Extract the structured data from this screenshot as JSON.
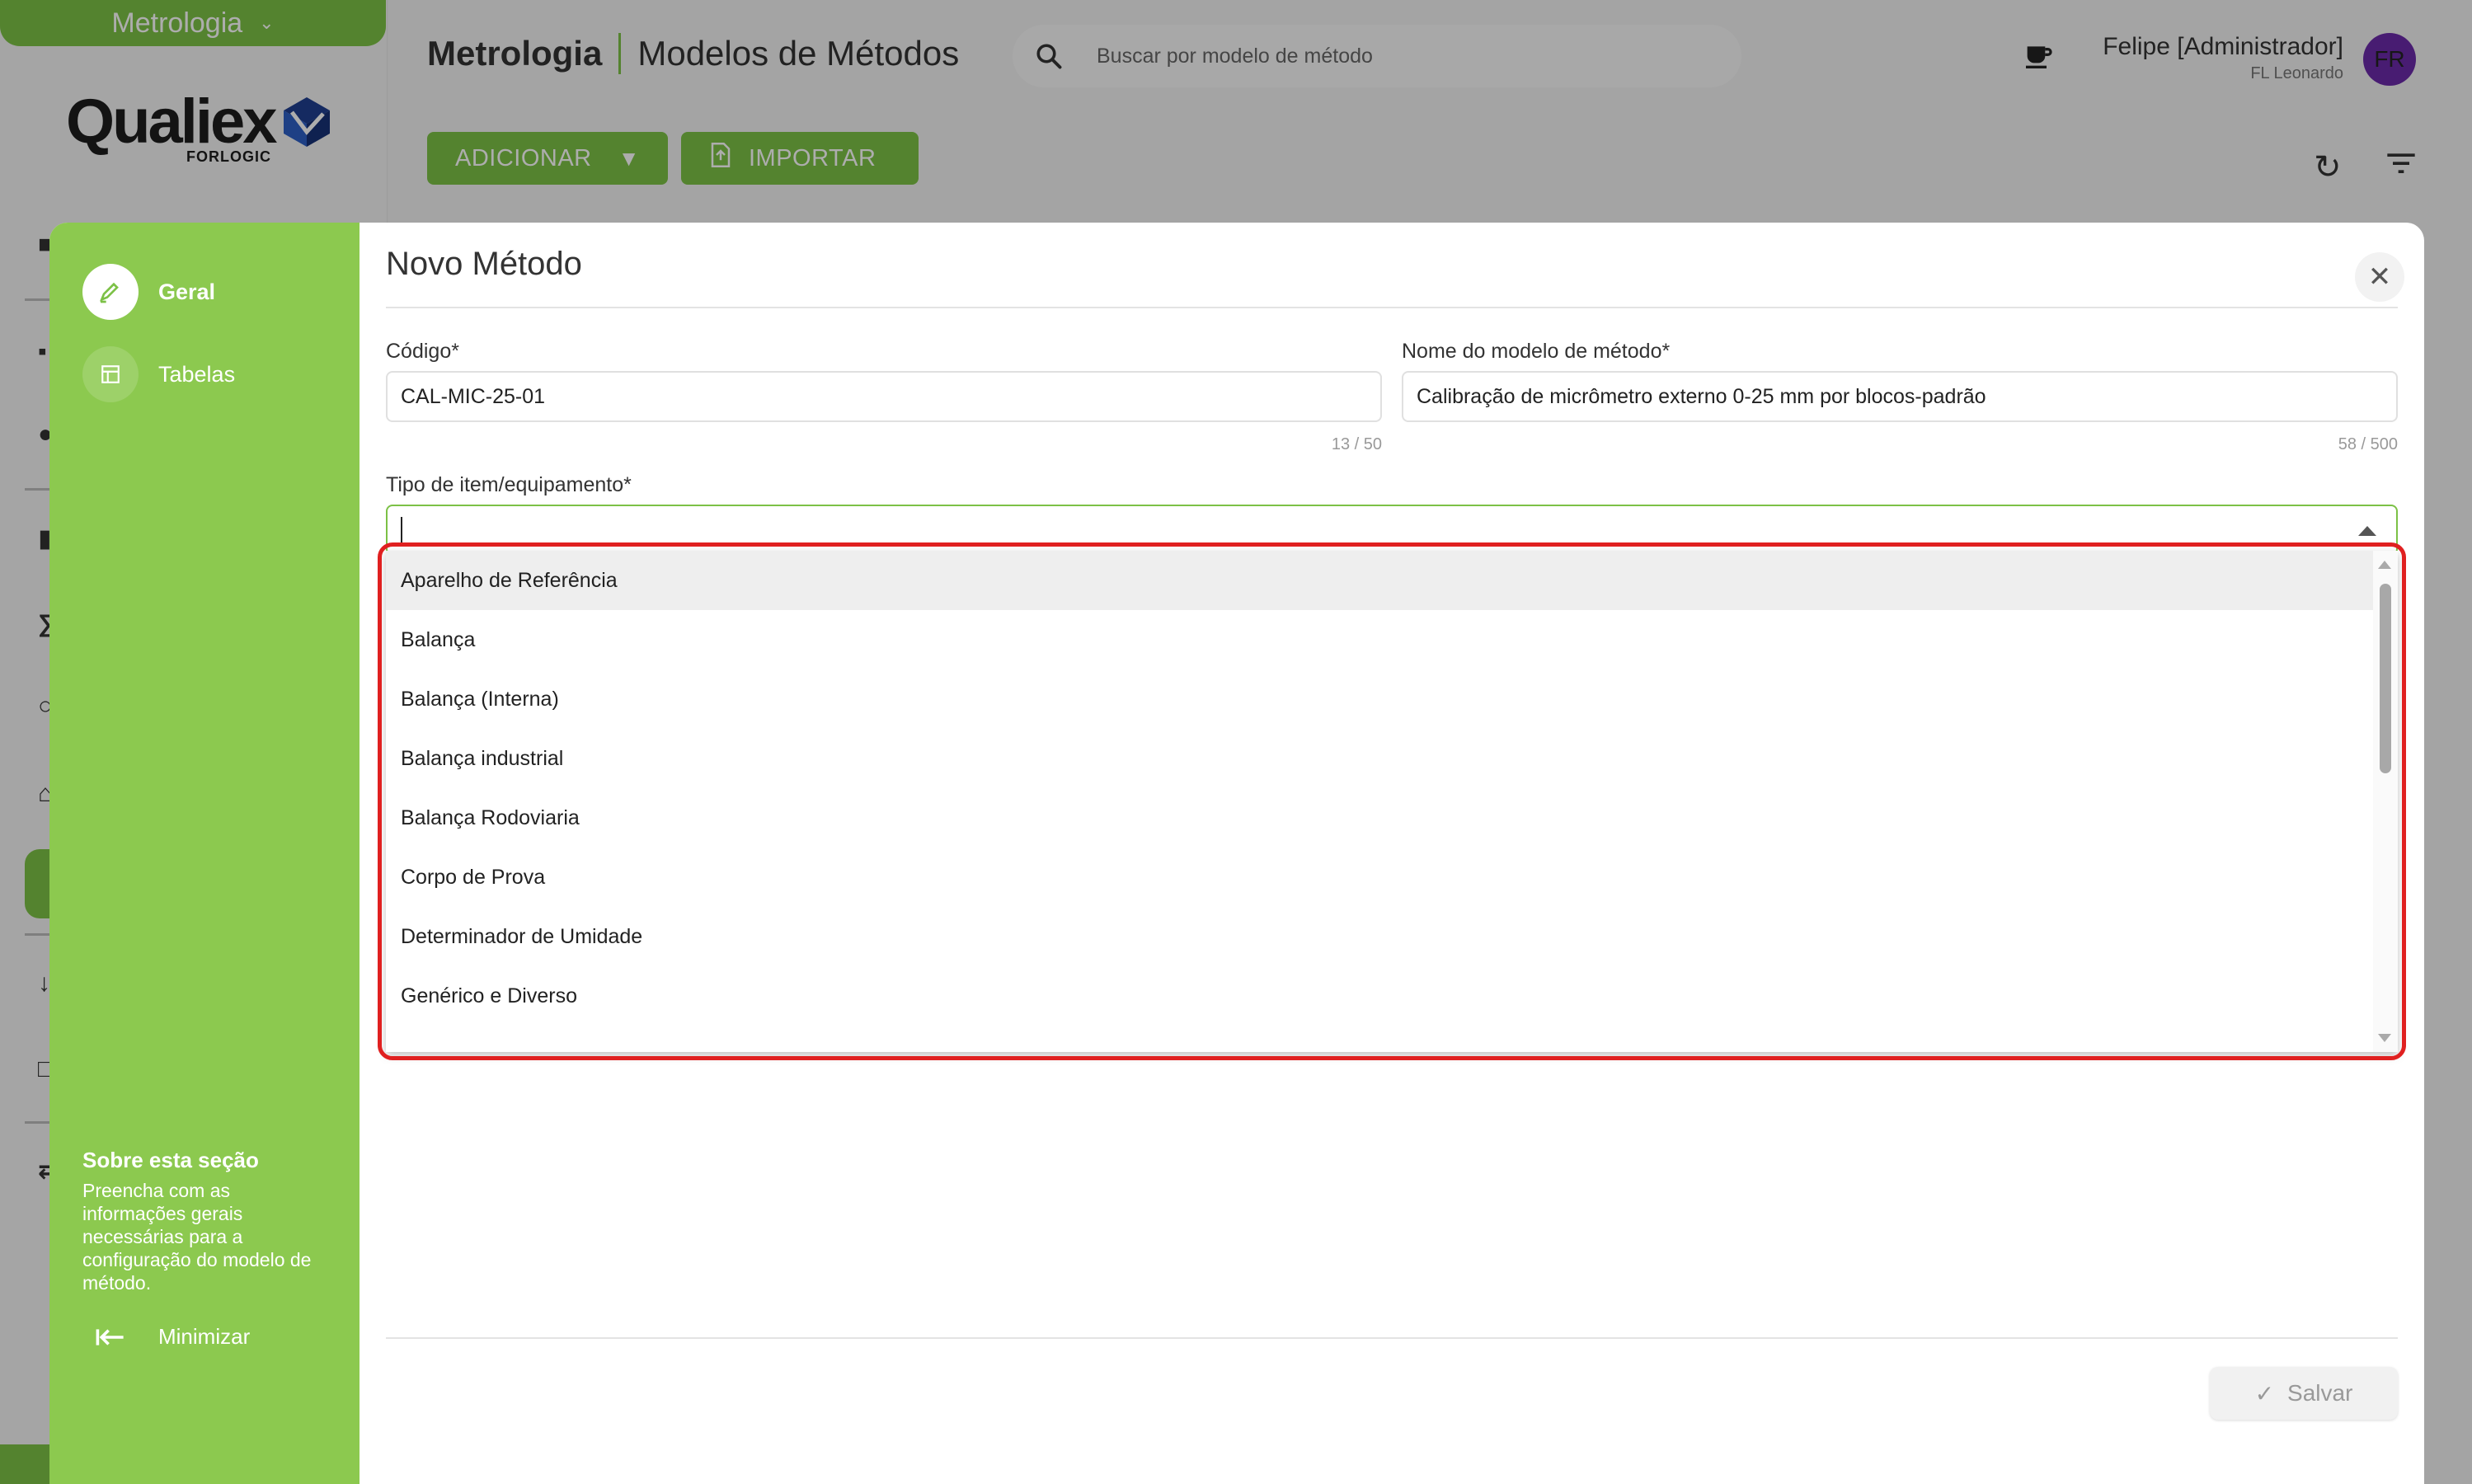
{
  "app": {
    "module": "Metrologia",
    "brand": "Qualiex",
    "brand_sub": "FORLOGIC",
    "accent_color": "#7cc146"
  },
  "header": {
    "module": "Metrologia",
    "page": "Modelos de Métodos",
    "search_placeholder": "Buscar por modelo de método",
    "user_name": "Felipe [Administrador]",
    "user_company": "FL Leonardo",
    "avatar_initials": "FR"
  },
  "toolbar": {
    "add_label": "ADICIONAR",
    "import_label": "IMPORTAR"
  },
  "modal": {
    "title": "Novo Método",
    "nav": [
      {
        "label": "Geral",
        "icon": "edit-icon",
        "active": true
      },
      {
        "label": "Tabelas",
        "icon": "table-icon",
        "active": false
      }
    ],
    "about_title": "Sobre esta seção",
    "about_text": "Preencha com as informações gerais necessárias para a configuração do modelo de método.",
    "minimize_label": "Minimizar",
    "fields": {
      "code": {
        "label": "Código*",
        "value": "CAL-MIC-25-01",
        "count": "13 / 50"
      },
      "name": {
        "label": "Nome do modelo de método*",
        "value": "Calibração de micrômetro externo 0-25 mm por blocos-padrão",
        "count": "58 / 500"
      },
      "type": {
        "label": "Tipo de item/equipamento*",
        "value": ""
      }
    },
    "dropdown_options": [
      "Aparelho de Referência",
      "Balança",
      "Balança (Interna)",
      "Balança industrial",
      "Balança Rodoviaria",
      "Corpo de Prova",
      "Determinador de Umidade",
      "Genérico e Diverso"
    ],
    "save_label": "Salvar",
    "highlight_color": "#e02020"
  }
}
